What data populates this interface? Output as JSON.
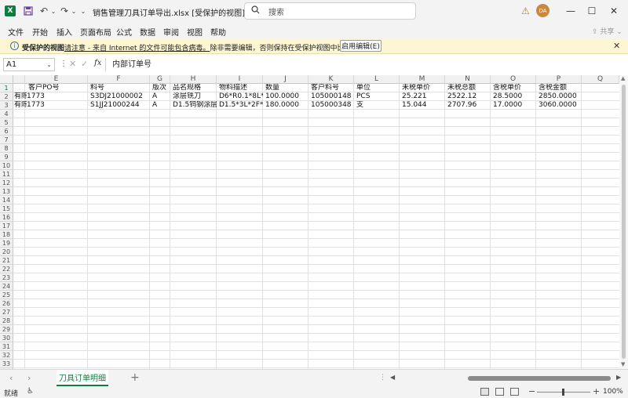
{
  "titlebar": {
    "app_logo": "X",
    "title": "销售管理刀具订单导出.xlsx  [受保护的视图]  -  Ex...",
    "search_placeholder": "搜索",
    "avatar_initials": "DA",
    "icons": [
      "save-icon",
      "undo-icon",
      "redo-icon",
      "warning-icon",
      "minimize-icon",
      "maximize-icon",
      "close-icon"
    ]
  },
  "menu": {
    "items": [
      "文件",
      "开始",
      "插入",
      "页面布局",
      "公式",
      "数据",
      "审阅",
      "视图",
      "帮助"
    ],
    "share": "共享"
  },
  "protected_bar": {
    "title": "受保护的视图",
    "message_prefix": "请注意 - 来自 Internet 的文件可能包含病毒。",
    "message_link": "除非需要编辑，否则保持在受保护视图中比较安全。",
    "button": "启用编辑(E)"
  },
  "formula_bar": {
    "name_box": "A1",
    "fx": "fx",
    "content": "内部订单号"
  },
  "grid": {
    "columns": [
      "E",
      "F",
      "G",
      "H",
      "I",
      "J",
      "K",
      "L",
      "M",
      "N",
      "O",
      "P",
      "Q"
    ],
    "row_numbers": [
      "1",
      "2",
      "3",
      "4",
      "5",
      "6",
      "7",
      "8",
      "9",
      "10",
      "11",
      "12",
      "13",
      "14",
      "15",
      "16",
      "17",
      "18",
      "19",
      "20",
      "21",
      "22",
      "23",
      "24",
      "25",
      "26",
      "27",
      "28",
      "29",
      "30",
      "31",
      "32",
      "33",
      "34"
    ],
    "row1": {
      "a": "1",
      "e": "客户PO号",
      "f": "料号",
      "g": "版次",
      "h": "品名规格",
      "i": "物料描述",
      "j": "数量",
      "k": "客户料号",
      "l": "单位",
      "m": "未税单价",
      "n": "未税总额",
      "o": "含税单价",
      "p": "含税金额"
    },
    "rows": [
      {
        "a": "有陈",
        "e": "1773",
        "f": "S3DJ21000002",
        "g": "A",
        "h": "涂层铣刀",
        "i": "D6*R0.1*8L*4",
        "j": "100.0000",
        "k": "105000148",
        "l": "PCS",
        "m": "25.221",
        "n": "2522.12",
        "o": "28.5000",
        "p": "2850.0000"
      },
      {
        "a": "有陈",
        "e": "1773",
        "f": "S1JJ21000244",
        "g": "A",
        "h": "D1.5钨钢涂层",
        "i": "D1.5*3L*2F*D",
        "j": "180.0000",
        "k": "105000348",
        "l": "支",
        "m": "15.044",
        "n": "2707.96",
        "o": "17.0000",
        "p": "3060.0000"
      }
    ]
  },
  "sheet_tabs": {
    "active": "刀具订单明细",
    "add": "+"
  },
  "status": {
    "ready": "就绪",
    "zoom": "100%"
  }
}
